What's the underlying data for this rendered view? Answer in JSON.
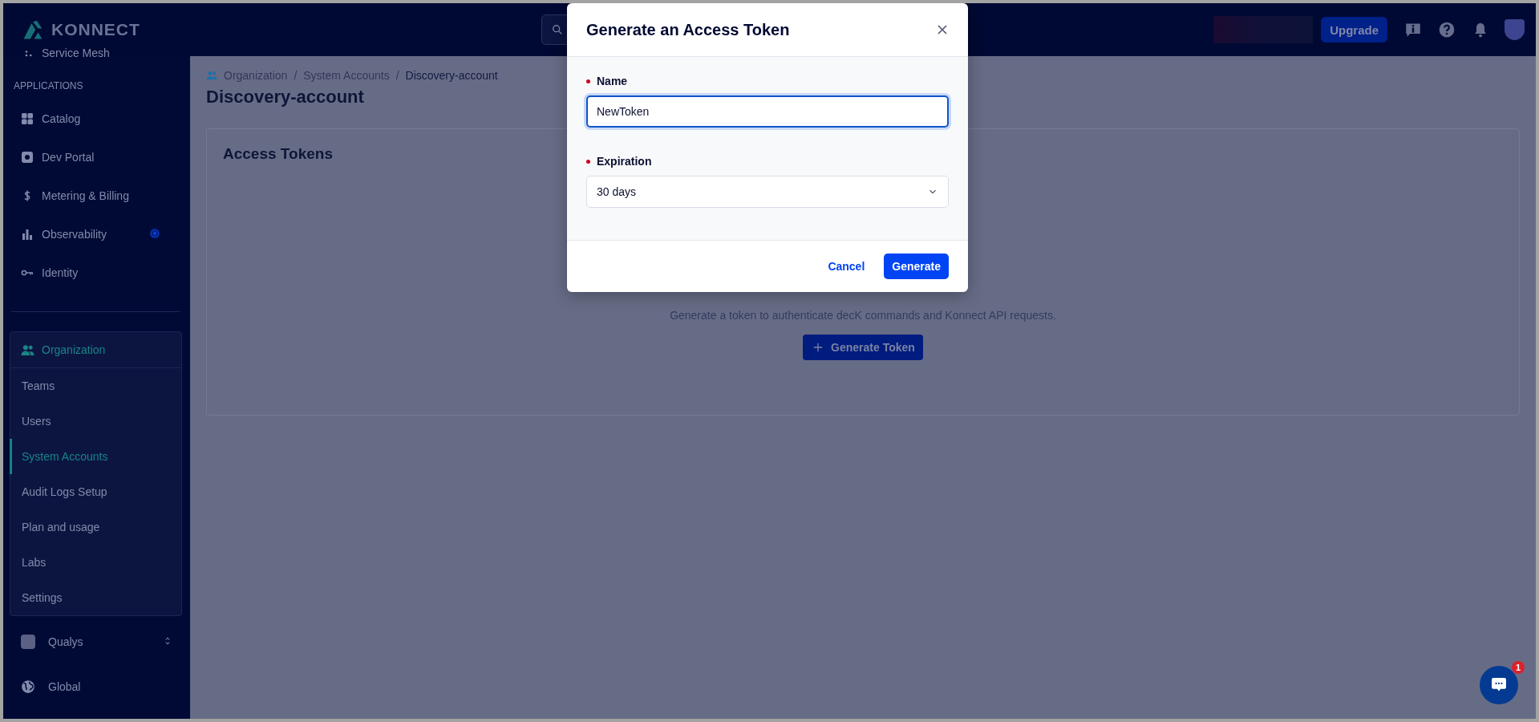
{
  "topbar": {
    "logo": "KONNECT",
    "upgrade": "Upgrade"
  },
  "sidebar": {
    "partial_item": "Service Mesh",
    "section": "APPLICATIONS",
    "items": [
      {
        "label": "Catalog"
      },
      {
        "label": "Dev Portal"
      },
      {
        "label": "Metering & Billing"
      },
      {
        "label": "Observability"
      },
      {
        "label": "Identity"
      }
    ],
    "organization": {
      "label": "Organization",
      "items": [
        {
          "label": "Teams",
          "selected": false
        },
        {
          "label": "Users",
          "selected": false
        },
        {
          "label": "System Accounts",
          "selected": true
        },
        {
          "label": "Audit Logs Setup",
          "selected": false
        },
        {
          "label": "Plan and usage",
          "selected": false
        },
        {
          "label": "Labs",
          "selected": false
        },
        {
          "label": "Settings",
          "selected": false
        }
      ]
    },
    "workspace": "Qualys",
    "region": "Global"
  },
  "breadcrumb": [
    {
      "kind": "link",
      "label": "Organization"
    },
    {
      "kind": "separator",
      "label": "/"
    },
    {
      "kind": "link",
      "label": "System Accounts"
    },
    {
      "kind": "separator",
      "label": "/"
    },
    {
      "kind": "current",
      "label": "Discovery-account"
    }
  ],
  "page": {
    "title": "Discovery-account",
    "card_title": "Access Tokens",
    "empty_text": "Generate a token to authenticate decK commands and Konnect API requests.",
    "button": "Generate Token"
  },
  "dialog": {
    "title": "Generate an Access Token",
    "fields": [
      {
        "kind": "text",
        "label": "Name",
        "required": true,
        "value": "NewToken",
        "focused": true
      },
      {
        "kind": "select",
        "label": "Expiration",
        "required": true,
        "value": "30 days",
        "focused": false
      }
    ],
    "cancel": "Cancel",
    "confirm": "Generate"
  },
  "chat": {
    "badge": "1"
  }
}
